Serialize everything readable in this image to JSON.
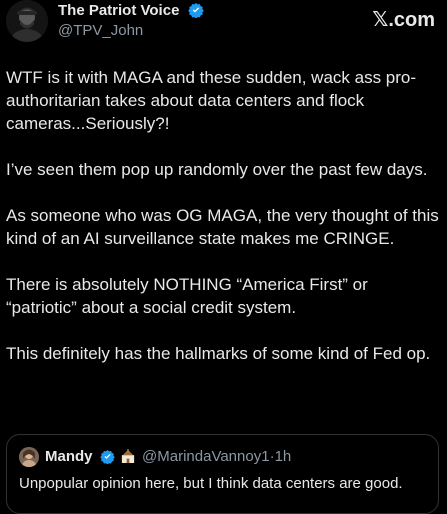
{
  "author": {
    "display_name": "The Patriot Voice",
    "handle": "@TPV_John",
    "verified_icon": "verified-badge-icon"
  },
  "source": {
    "logo": "𝕏",
    "domain": ".com"
  },
  "tweet": {
    "paragraphs": [
      "WTF is it with MAGA and these sudden, wack ass pro-authoritarian takes about data centers and flock cameras...Seriously?!",
      "I’ve seen them pop up randomly over the past few days.",
      "As someone who was OG MAGA, the very thought of this kind of an AI surveillance state makes me CRINGE.",
      "There is absolutely NOTHING “America First” or “patriotic” about a social credit system.",
      "This definitely has the hallmarks of some kind of Fed op."
    ]
  },
  "quoted_tweet": {
    "display_name": "Mandy",
    "handle": "@MarindaVannoy1",
    "separator": "·",
    "time": "1h",
    "text": "Unpopular opinion here, but I think data centers are good.",
    "badge_icon": "verified-badge-icon",
    "emoji_icon": "church-emoji-icon"
  },
  "colors": {
    "background": "#000000",
    "text": "#e7e9ea",
    "secondary_text": "#8b98a5",
    "verified": "#1d9bf0",
    "border": "#2f3336"
  }
}
